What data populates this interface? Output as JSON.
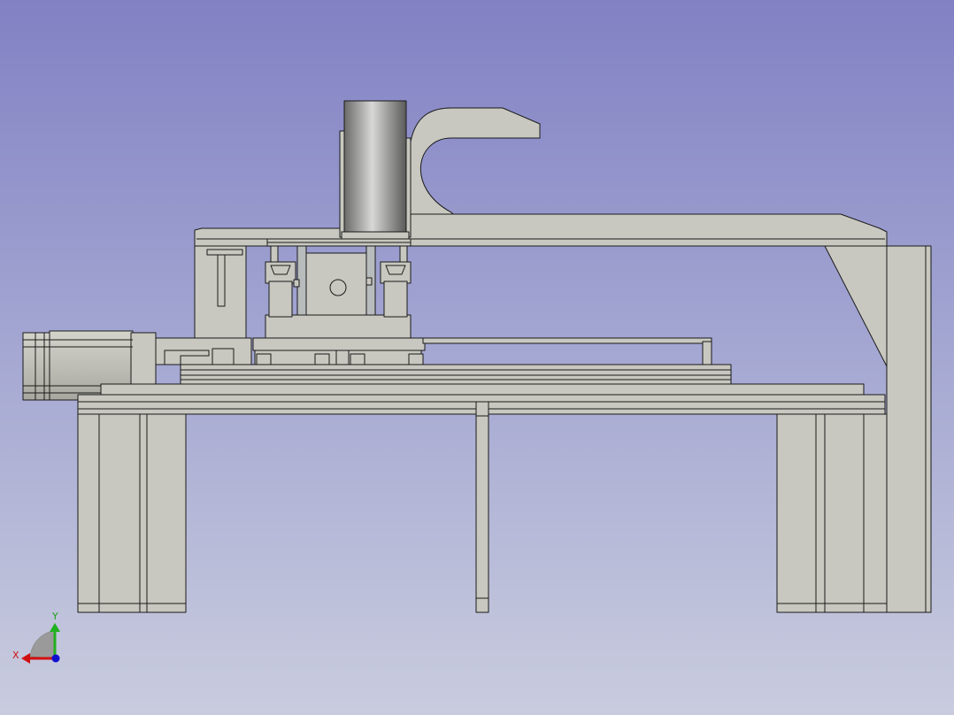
{
  "viewer": {
    "background_top": "#8181c4",
    "background_bottom": "#c9ccde",
    "part_fill": "#c8c8c0",
    "part_stroke": "#1a1a1a"
  },
  "axis_indicator": {
    "x_label": "X",
    "y_label": "Y",
    "x_color": "#d01010",
    "y_color": "#20a020",
    "z_color": "#1010d0"
  }
}
